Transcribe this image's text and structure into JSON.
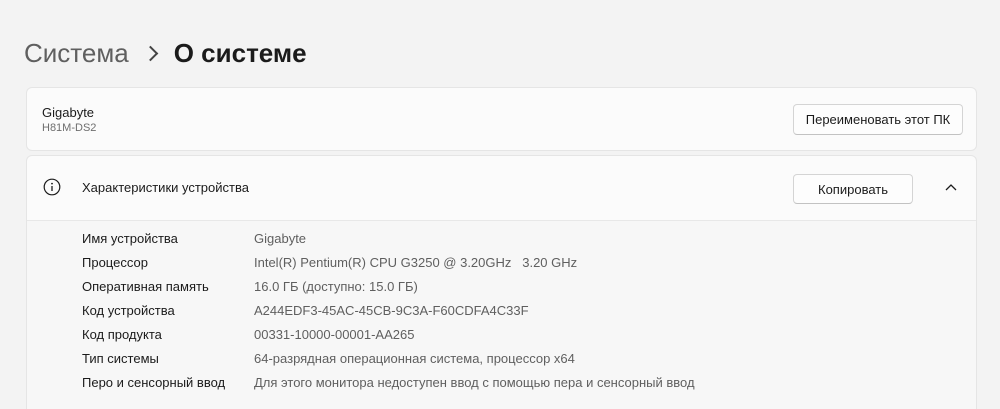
{
  "breadcrumb": {
    "parent": "Система",
    "current": "О системе"
  },
  "pc": {
    "name": "Gigabyte",
    "model": "H81M-DS2",
    "rename_label": "Переименовать этот ПК"
  },
  "specs": {
    "title": "Характеристики устройства",
    "copy_label": "Копировать",
    "rows": [
      {
        "label": "Имя устройства",
        "value": "Gigabyte"
      },
      {
        "label": "Процессор",
        "value": "Intel(R) Pentium(R) CPU G3250 @ 3.20GHz   3.20 GHz"
      },
      {
        "label": "Оперативная память",
        "value": "16.0 ГБ (доступно: 15.0 ГБ)"
      },
      {
        "label": "Код устройства",
        "value": "A244EDF3-45AC-45CB-9C3A-F60CDFA4C33F"
      },
      {
        "label": "Код продукта",
        "value": "00331-10000-00001-AA265"
      },
      {
        "label": "Тип системы",
        "value": "64-разрядная операционная система, процессор x64"
      },
      {
        "label": "Перо и сенсорный ввод",
        "value": "Для этого монитора недоступен ввод с помощью пера и сенсорный ввод"
      }
    ]
  },
  "icons": {
    "info": "info-icon",
    "chevron": "chevron-up-icon",
    "separator": "chevron-right-icon"
  }
}
